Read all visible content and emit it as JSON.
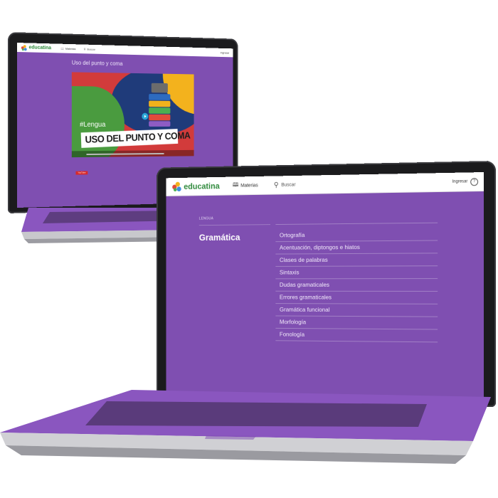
{
  "brand": {
    "name": "educatina",
    "green": "#2f8a3c",
    "purple": "#7f4fb1"
  },
  "back_screen": {
    "nav_materias": "Materias",
    "nav_buscar": "Buscar",
    "login": "Ingresar",
    "video_title": "Uso del punto y coma",
    "video_hashtag": "#Lengua",
    "video_banner": "USO DEL PUNTO Y COMA",
    "youtube_label": "YouTube"
  },
  "front_screen": {
    "nav_materias": "Materias",
    "nav_buscar": "Buscar",
    "login": "Ingresar",
    "help_icon": "?",
    "section_label": "LENGUA",
    "section_title": "Gramática",
    "topics": [
      "Ortografía",
      "Acentuación, diptongos e hiatos",
      "Clases de palabras",
      "Sintaxis",
      "Dudas gramaticales",
      "Errores gramaticales",
      "Gramática funcional",
      "Morfología",
      "Fonología"
    ]
  }
}
